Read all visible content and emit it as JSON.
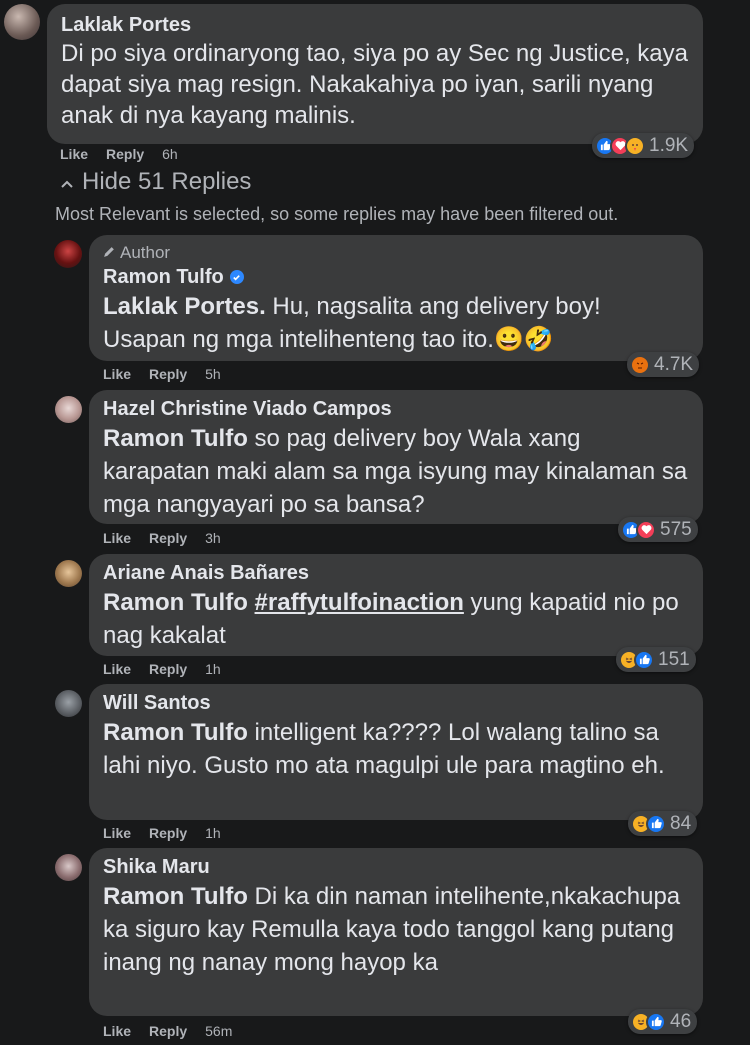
{
  "colors": {
    "background": "#18191a",
    "bubble": "#3a3b3c",
    "text": "#e4e6eb",
    "secondary": "#b0b3b8",
    "like": "#1877f2",
    "love": "#f33e58",
    "haha": "#f7b125",
    "verified": "#2d88ff"
  },
  "top_comment": {
    "name": "Laklak Portes",
    "text": "Di po siya ordinaryong tao, siya po ay Sec ng Justice, kaya dapat siya mag resign. Nakakahiya po iyan, sarili nyang anak di nya kayang malinis.",
    "like_label": "Like",
    "reply_label": "Reply",
    "time": "6h",
    "reaction_count": "1.9K",
    "reaction_icons": [
      "like-icon",
      "love-icon",
      "care-icon"
    ]
  },
  "replies_toggle": {
    "icon": "chevron-up-icon",
    "label": "Hide 51 Replies"
  },
  "filter_note": "Most Relevant is selected, so some replies may have been filtered out.",
  "replies": [
    {
      "author_tag": "Author",
      "name": "Ramon Tulfo",
      "verified": true,
      "mention": "Laklak Portes.",
      "text": " Hu, nagsalita ang delivery boy! Usapan ng mga intelihenteng tao ito.😀🤣",
      "like_label": "Like",
      "reply_label": "Reply",
      "time": "5h",
      "reaction_count": "4.7K",
      "reaction_icons": [
        "angry-icon"
      ]
    },
    {
      "name": "Hazel Christine Viado Campos",
      "mention": "Ramon Tulfo",
      "text": " so pag delivery boy Wala xang karapatan maki alam sa mga isyung may kinalaman sa mga nangyayari po sa bansa?",
      "like_label": "Like",
      "reply_label": "Reply",
      "time": "3h",
      "reaction_count": "575",
      "reaction_icons": [
        "like-icon",
        "love-icon"
      ]
    },
    {
      "name": "Ariane Anais Bañares",
      "mention": "Ramon Tulfo",
      "hashtag": "#raffytulfoinaction",
      "text": " yung kapatid nio po nag kakalat",
      "like_label": "Like",
      "reply_label": "Reply",
      "time": "1h",
      "reaction_count": "151",
      "reaction_icons": [
        "haha-icon",
        "like-icon"
      ]
    },
    {
      "name": "Will Santos",
      "mention": "Ramon Tulfo",
      "text": " intelligent ka???? Lol walang talino sa lahi niyo. Gusto mo ata magulpi ule para magtino eh.",
      "like_label": "Like",
      "reply_label": "Reply",
      "time": "1h",
      "reaction_count": "84",
      "reaction_icons": [
        "haha-icon",
        "like-icon"
      ]
    },
    {
      "name": "Shika Maru",
      "mention": "Ramon Tulfo",
      "text": " Di ka din naman intelihente,nkakachupa ka siguro kay Remulla kaya todo tanggol kang putang inang ng nanay mong hayop ka",
      "like_label": "Like",
      "reply_label": "Reply",
      "time": "56m",
      "reaction_count": "46",
      "reaction_icons": [
        "haha-icon",
        "like-icon"
      ]
    }
  ]
}
